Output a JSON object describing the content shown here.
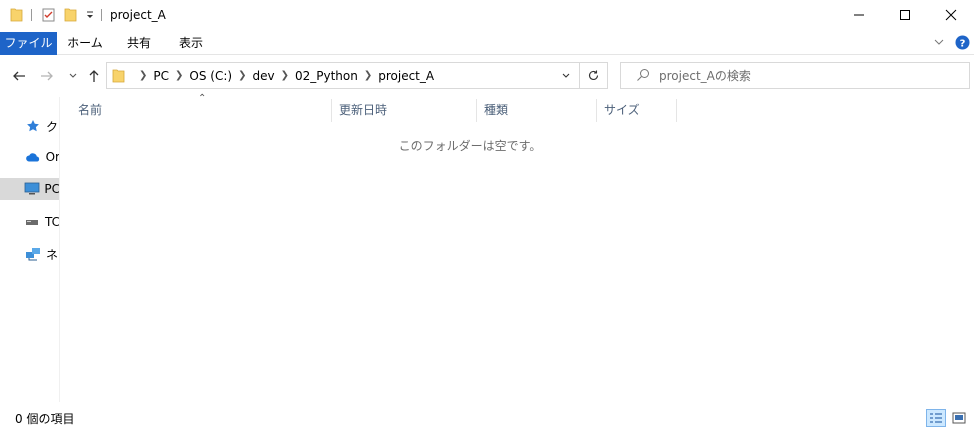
{
  "window": {
    "title": "project_A"
  },
  "ribbon": {
    "tabs": [
      "ファイル",
      "ホーム",
      "共有",
      "表示"
    ]
  },
  "address": {
    "crumbs": [
      "PC",
      "OS (C:)",
      "dev",
      "02_Python",
      "project_A"
    ]
  },
  "search": {
    "placeholder": "project_Aの検索"
  },
  "sidebar": {
    "items": [
      {
        "label": "ク",
        "icon": "star-icon"
      },
      {
        "label": "Or",
        "icon": "cloud-icon"
      },
      {
        "label": "PC",
        "icon": "computer-icon"
      },
      {
        "label": "TC",
        "icon": "drive-icon"
      },
      {
        "label": "ネ",
        "icon": "network-icon"
      }
    ]
  },
  "columns": [
    "名前",
    "更新日時",
    "種類",
    "サイズ"
  ],
  "content": {
    "empty_message": "このフォルダーは空です。"
  },
  "status": {
    "item_count": "0 個の項目"
  },
  "colors": {
    "accent": "#1e64c8",
    "help": "#1e64c8",
    "folder": "#f8d36b"
  }
}
